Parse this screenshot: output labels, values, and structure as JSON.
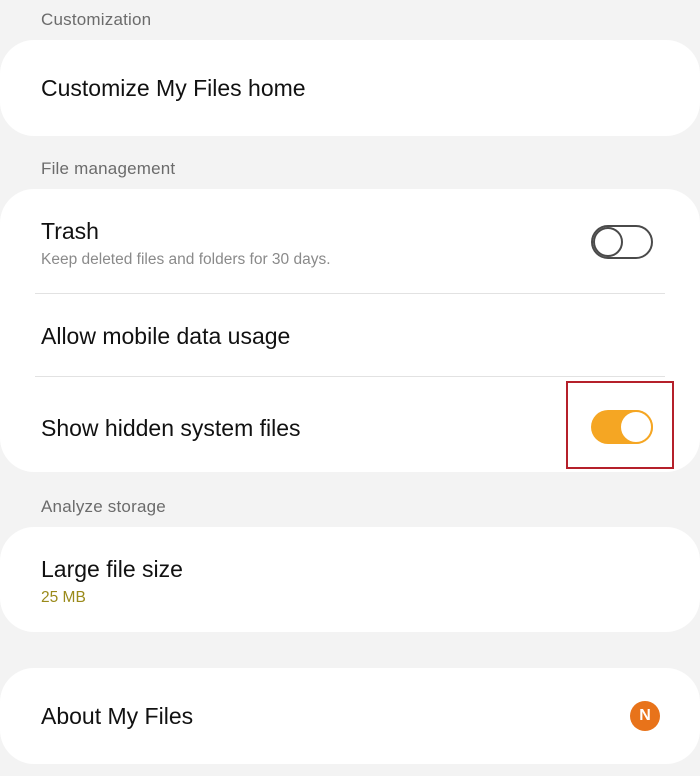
{
  "sections": {
    "customization": {
      "header": "Customization",
      "customize_home": "Customize My Files home"
    },
    "file_management": {
      "header": "File management",
      "trash": {
        "title": "Trash",
        "subtitle": "Keep deleted files and folders for 30 days.",
        "enabled": false
      },
      "mobile_data": {
        "title": "Allow mobile data usage"
      },
      "hidden_files": {
        "title": "Show hidden system files",
        "enabled": true
      }
    },
    "analyze_storage": {
      "header": "Analyze storage",
      "large_file": {
        "title": "Large file size",
        "value": "25 MB"
      }
    },
    "about": {
      "title": "About My Files",
      "badge": "N"
    }
  },
  "colors": {
    "toggle_on": "#f5a623",
    "highlight": "#b5202a",
    "badge": "#e8731a",
    "value_accent": "#9a8a1a"
  }
}
